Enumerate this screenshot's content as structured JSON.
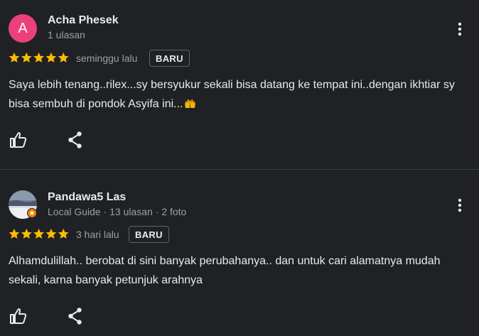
{
  "reviews": [
    {
      "avatar_letter": "A",
      "avatar_color": "#ec407a",
      "name": "Acha Phesek",
      "meta": "1 ulasan",
      "rating": 5,
      "time": "seminggu lalu",
      "badge": "BARU",
      "text": "Saya lebih tenang..rilex...sy bersyukur sekali bisa datang ke tempat ini..dengan ikhtiar sy bisa sembuh di pondok Asyifa ini...",
      "emoji": "raising-hands-icon"
    },
    {
      "avatar_letter": "",
      "name": "Pandawa5 Las",
      "meta": "Local Guide · 13 ulasan · 2 foto",
      "rating": 5,
      "time": "3 hari lalu",
      "badge": "BARU",
      "text": "Alhamdulillah.. berobat di sini banyak perubahanya.. dan untuk cari alamatnya mudah sekali, karna banyak petunjuk arahnya"
    }
  ],
  "colors": {
    "background": "#202124",
    "star": "#fbbc04",
    "text": "#e8eaed",
    "muted": "#9aa0a6",
    "local_guide_badge": "#f57c00"
  }
}
